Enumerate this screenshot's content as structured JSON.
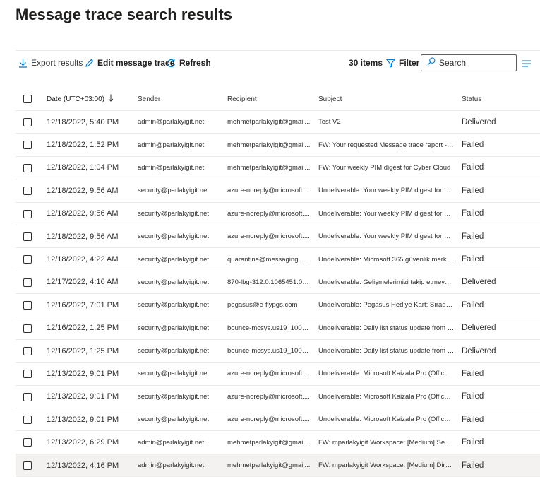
{
  "page": {
    "title": "Message trace search results"
  },
  "toolbar": {
    "export_label": "Export results",
    "edit_label": "Edit message trace",
    "refresh_label": "Refresh",
    "items_count": "30 items",
    "filter_label": "Filter",
    "search_placeholder": "Search"
  },
  "table": {
    "headers": {
      "date": "Date (UTC+03:00)",
      "sender": "Sender",
      "recipient": "Recipient",
      "subject": "Subject",
      "status": "Status"
    },
    "rows": [
      {
        "date": "12/18/2022, 5:40 PM",
        "sender": "admin@parlakyigit.net",
        "recipient": "mehmetparlakyigit@gmail...",
        "subject": "Test V2",
        "status": "Delivered"
      },
      {
        "date": "12/18/2022, 1:52 PM",
        "sender": "admin@parlakyigit.net",
        "recipient": "mehmetparlakyigit@gmail...",
        "subject": "FW: Your requested Message trace report - 2...",
        "status": "Failed"
      },
      {
        "date": "12/18/2022, 1:04 PM",
        "sender": "admin@parlakyigit.net",
        "recipient": "mehmetparlakyigit@gmail...",
        "subject": "FW: Your weekly PIM digest for Cyber Cloud",
        "status": "Failed"
      },
      {
        "date": "12/18/2022, 9:56 AM",
        "sender": "security@parlakyigit.net",
        "recipient": "azure-noreply@microsoft....",
        "subject": "Undeliverable: Your weekly PIM digest for PA...",
        "status": "Failed"
      },
      {
        "date": "12/18/2022, 9:56 AM",
        "sender": "security@parlakyigit.net",
        "recipient": "azure-noreply@microsoft....",
        "subject": "Undeliverable: Your weekly PIM digest for PA...",
        "status": "Failed"
      },
      {
        "date": "12/18/2022, 9:56 AM",
        "sender": "security@parlakyigit.net",
        "recipient": "azure-noreply@microsoft....",
        "subject": "Undeliverable: Your weekly PIM digest for PA...",
        "status": "Failed"
      },
      {
        "date": "12/18/2022, 4:22 AM",
        "sender": "security@parlakyigit.net",
        "recipient": "quarantine@messaging.mi...",
        "subject": "Undeliverable: Microsoft 365 güvenlik merkez...",
        "status": "Failed"
      },
      {
        "date": "12/17/2022, 4:16 AM",
        "sender": "security@parlakyigit.net",
        "recipient": "870-lbg-312.0.1065451.0.0...",
        "subject": "Undeliverable: Gelişmelerimizi takip etmeye d...",
        "status": "Delivered"
      },
      {
        "date": "12/16/2022, 7:01 PM",
        "sender": "security@parlakyigit.net",
        "recipient": "pegasus@e-flypgs.com",
        "subject": "Undeliverable: Pegasus Hediye Kart: Sıradan ...",
        "status": "Failed"
      },
      {
        "date": "12/16/2022, 1:25 PM",
        "sender": "security@parlakyigit.net",
        "recipient": "bounce-mcsys.us19_10006...",
        "subject": "Undeliverable: Daily list status update from M...",
        "status": "Delivered"
      },
      {
        "date": "12/16/2022, 1:25 PM",
        "sender": "security@parlakyigit.net",
        "recipient": "bounce-mcsys.us19_10006...",
        "subject": "Undeliverable: Daily list status update from M...",
        "status": "Delivered"
      },
      {
        "date": "12/13/2022, 9:01 PM",
        "sender": "security@parlakyigit.net",
        "recipient": "azure-noreply@microsoft....",
        "subject": "Undeliverable: Microsoft Kaizala Pro (Office 3...",
        "status": "Failed"
      },
      {
        "date": "12/13/2022, 9:01 PM",
        "sender": "security@parlakyigit.net",
        "recipient": "azure-noreply@microsoft....",
        "subject": "Undeliverable: Microsoft Kaizala Pro (Office 3...",
        "status": "Failed"
      },
      {
        "date": "12/13/2022, 9:01 PM",
        "sender": "security@parlakyigit.net",
        "recipient": "azure-noreply@microsoft....",
        "subject": "Undeliverable: Microsoft Kaizala Pro (Office 3...",
        "status": "Failed"
      },
      {
        "date": "12/13/2022, 6:29 PM",
        "sender": "admin@parlakyigit.net",
        "recipient": "mehmetparlakyigit@gmail...",
        "subject": "FW: mparlakyigit Workspace: [Medium] Sens...",
        "status": "Failed"
      },
      {
        "date": "12/13/2022, 4:16 PM",
        "sender": "admin@parlakyigit.net",
        "recipient": "mehmetparlakyigit@gmail...",
        "subject": "FW: mparlakyigit Workspace: [Medium] Direc...",
        "status": "Failed"
      }
    ]
  },
  "colors": {
    "accent": "#0078d4",
    "text": "#323130",
    "divider": "#edebe9",
    "row_hover": "#f3f2f1"
  },
  "icons": {
    "export": "download-arrow-icon",
    "edit": "pencil-icon",
    "refresh": "refresh-icon",
    "filter": "funnel-icon",
    "search": "magnifier-icon",
    "menu": "lines-icon",
    "sort": "arrow-down-icon"
  }
}
